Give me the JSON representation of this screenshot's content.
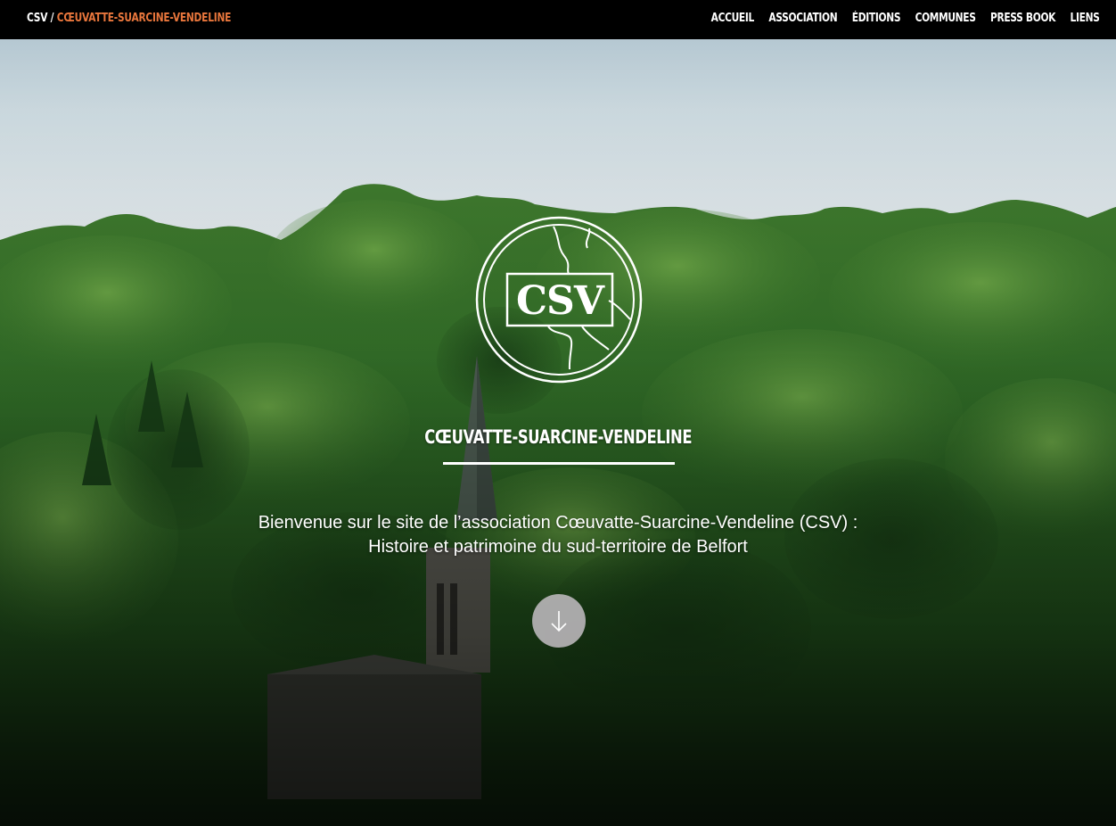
{
  "navbar": {
    "brand_prefix": "CSV /",
    "brand_name": "Cœuvatte-Suarcine-Vendeline",
    "brand_accent_color": "#e8763c",
    "menu": [
      {
        "label": "Accueil"
      },
      {
        "label": "Association"
      },
      {
        "label": "Éditions"
      },
      {
        "label": "Communes"
      },
      {
        "label": "Press book"
      },
      {
        "label": "Liens"
      }
    ]
  },
  "hero": {
    "logo_text": "CSV",
    "title": "Cœuvatte-Suarcine-Vendeline",
    "tagline_line1": "Bienvenue sur le site de l’association Cœuvatte-Suarcine-Vendeline (CSV) :",
    "tagline_line2": "Histoire et patrimoine du sud-territoire de Belfort",
    "scroll_icon": "arrow-down-icon",
    "background": "forest-with-church-steeple-photo"
  }
}
